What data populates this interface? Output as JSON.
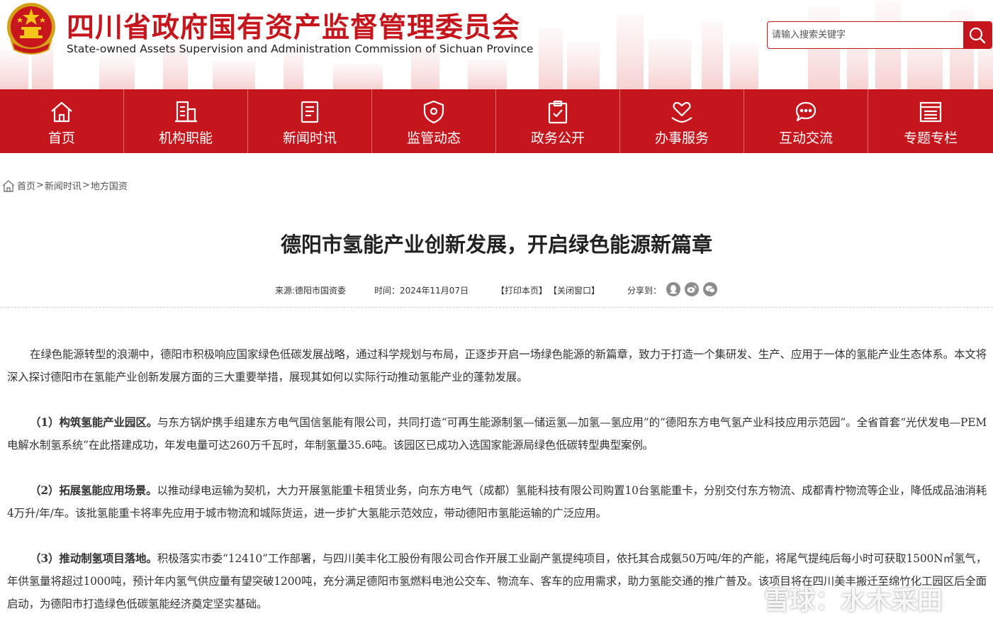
{
  "header": {
    "title_cn": "四川省政府国有资产监督管理委员会",
    "title_en": "State-owned Assets Supervision and Administration Commission of Sichuan Province",
    "search_placeholder": "请输入搜索关键字"
  },
  "nav": {
    "items": [
      {
        "label": "首页",
        "icon": "home-icon"
      },
      {
        "label": "机构职能",
        "icon": "building-icon"
      },
      {
        "label": "新闻时讯",
        "icon": "document-icon"
      },
      {
        "label": "监管动态",
        "icon": "shield-icon"
      },
      {
        "label": "政务公开",
        "icon": "clipboard-check-icon"
      },
      {
        "label": "办事服务",
        "icon": "heart-hand-icon"
      },
      {
        "label": "互动交流",
        "icon": "chat-icon"
      },
      {
        "label": "专题专栏",
        "icon": "list-icon"
      }
    ]
  },
  "breadcrumb": {
    "home": "首页",
    "sep": ">",
    "level1": "新闻时讯",
    "level2": "地方国资"
  },
  "article": {
    "title": "德阳市氢能产业创新发展，开启绿色能源新篇章",
    "source": "来源:德阳市国资委",
    "time": "时间：2024年11月07日",
    "print": "【打印本页】",
    "close": "【关闭窗口】",
    "share_label": "分享到：",
    "share_icons": [
      "qq-icon",
      "weibo-icon",
      "wechat-icon"
    ],
    "paragraphs": [
      {
        "lead": "",
        "text": "在绿色能源转型的浪潮中，德阳市积极响应国家绿色低碳发展战略，通过科学规划与布局，正逐步开启一场绿色能源的新篇章，致力于打造一个集研发、生产、应用于一体的氢能产业生态体系。本文将深入探讨德阳市在氢能产业创新发展方面的三大重要举措，展现其如何以实际行动推动氢能产业的蓬勃发展。"
      },
      {
        "lead": "（1）构筑氢能产业园区。",
        "text": "与东方锅炉携手组建东方电气国信氢能有限公司，共同打造“可再生能源制氢—储运氢—加氢—氢应用”的“德阳东方电气氢产业科技应用示范园”。全省首套“光伏发电—PEM电解水制氢系统”在此搭建成功，年发电量可达260万千瓦时，年制氢量35.6吨。该园区已成功入选国家能源局绿色低碳转型典型案例。"
      },
      {
        "lead": "（2）拓展氢能应用场景。",
        "text": "以推动绿电运输为契机，大力开展氢能重卡租赁业务，向东方电气（成都）氢能科技有限公司购置10台氢能重卡，分别交付东方物流、成都青柠物流等企业，降低成品油消耗4万升/年/车。该批氢能重卡将率先应用于城市物流和城际货运，进一步扩大氢能示范效应，带动德阳市氢能运输的广泛应用。"
      },
      {
        "lead": "（3）推动制氢项目落地。",
        "text": "积极落实市委“12410”工作部署，与四川美丰化工股份有限公司合作开展工业副产氢提纯项目，依托其合成氨50万吨/年的产能，将尾气提纯后每小时可获取1500N㎥氢气，年供氢量将超过1000吨，预计年内氢气供应量有望突破1200吨，充分满足德阳市氢燃料电池公交车、物流车、客车的应用需求，助力氢能交通的推广普及。该项目将在四川美丰搬迁至绵竹化工园区后全面启动，为德阳市打造绿色低碳氢能经济奠定坚实基础。"
      }
    ]
  },
  "watermark": {
    "text": "雪球：水木采田"
  },
  "colors": {
    "brand_red": "#c4161c",
    "nav_divider": "#e46a6e"
  }
}
